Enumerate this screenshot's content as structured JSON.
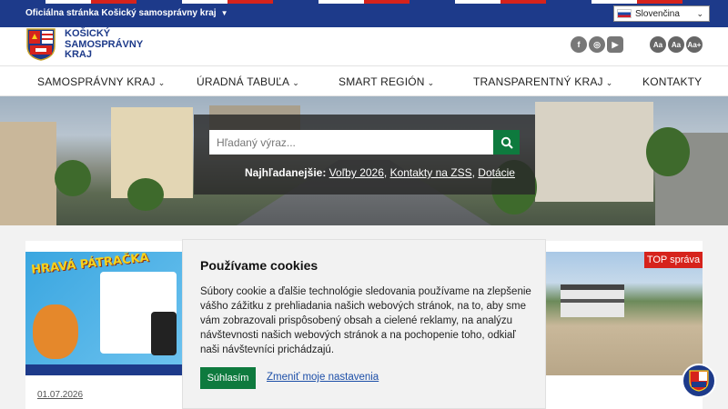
{
  "topbar": {
    "official_label": "Oficiálna stránka Košický samosprávny kraj",
    "language": "Slovenčina"
  },
  "brand": {
    "line1": "KOŠICKÝ",
    "line2": "SAMOSPRÁVNY",
    "line3": "KRAJ"
  },
  "social": [
    {
      "icon": "facebook-icon",
      "glyph": "f"
    },
    {
      "icon": "instagram-icon",
      "glyph": "◎"
    },
    {
      "icon": "youtube-icon",
      "glyph": "▶"
    }
  ],
  "font_size": [
    "Aa",
    "Aa",
    "Aa+"
  ],
  "nav": [
    {
      "label": "SAMOSPRÁVNY KRAJ",
      "has_dropdown": true
    },
    {
      "label": "ÚRADNÁ TABUĽA",
      "has_dropdown": true
    },
    {
      "label": "SMART REGIÓN",
      "has_dropdown": true
    },
    {
      "label": "TRANSPARENTNÝ KRAJ",
      "has_dropdown": true
    },
    {
      "label": "KONTAKTY",
      "has_dropdown": false
    }
  ],
  "search": {
    "placeholder": "Hľadaný výraz...",
    "popular_label": "Najhľadanejšie:",
    "popular_links": [
      "Voľby 2026",
      "Kontakty na ZSS",
      "Dotácie"
    ]
  },
  "news": {
    "left_date": "01.07.2026",
    "poster_title": "HRAVÁ PÁTRAČKA",
    "top_badge": "TOP správa"
  },
  "cookie": {
    "title": "Používame cookies",
    "text": "Súbory cookie a ďalšie technológie sledovania používame na zlepšenie vášho zážitku z prehliadania našich webových stránok, na to, aby sme vám zobrazovali prispôsobený obsah a cielené reklamy, na analýzu návštevnosti našich webových stránok a na pochopenie toho, odkiaľ naši návštevníci prichádzajú.",
    "agree_label": "Súhlasím",
    "change_label": "Zmeniť moje nastavenia"
  },
  "colors": {
    "primary": "#1d3a8a",
    "accent": "#0e7a3e",
    "alert": "#d6231c"
  }
}
